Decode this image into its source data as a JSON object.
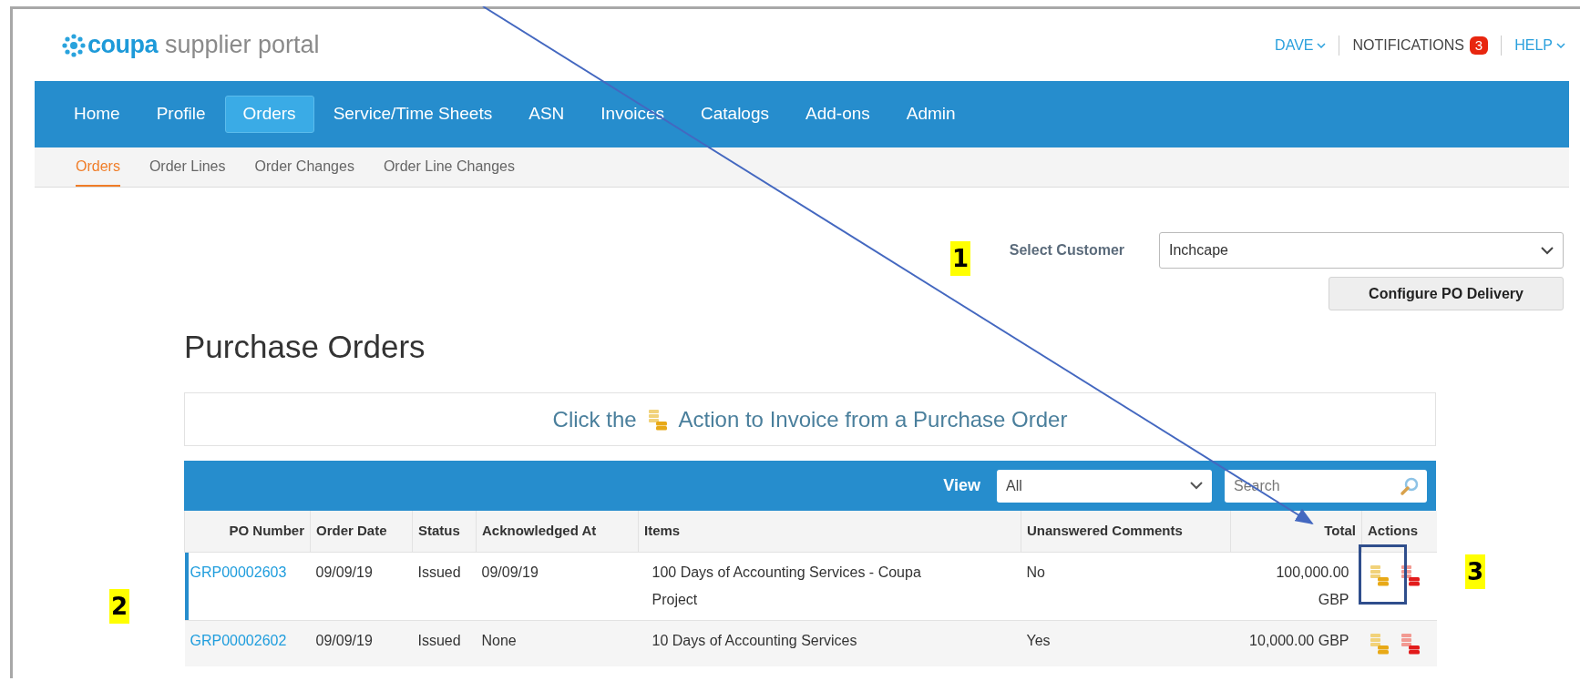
{
  "header": {
    "logo_brand": "coupa",
    "logo_product": "supplier portal",
    "user_menu": "DAVE",
    "notifications_label": "NOTIFICATIONS",
    "notifications_count": "3",
    "help_menu": "HELP"
  },
  "nav": [
    {
      "label": "Home",
      "selected": false
    },
    {
      "label": "Profile",
      "selected": false
    },
    {
      "label": "Orders",
      "selected": true
    },
    {
      "label": "Service/Time Sheets",
      "selected": false
    },
    {
      "label": "ASN",
      "selected": false
    },
    {
      "label": "Invoices",
      "selected": false
    },
    {
      "label": "Catalogs",
      "selected": false
    },
    {
      "label": "Add-ons",
      "selected": false
    },
    {
      "label": "Admin",
      "selected": false
    }
  ],
  "subnav": [
    {
      "label": "Orders",
      "selected": true
    },
    {
      "label": "Order Lines",
      "selected": false
    },
    {
      "label": "Order Changes",
      "selected": false
    },
    {
      "label": "Order Line Changes",
      "selected": false
    }
  ],
  "customer": {
    "label": "Select Customer",
    "value": "Inchcape"
  },
  "configure_button": "Configure PO Delivery",
  "page_title": "Purchase Orders",
  "banner": {
    "before": "Click the",
    "after": "Action to Invoice from a Purchase Order"
  },
  "table": {
    "view_label": "View",
    "view_value": "All",
    "search_placeholder": "Search",
    "columns": [
      "PO Number",
      "Order Date",
      "Status",
      "Acknowledged At",
      "Items",
      "Unanswered Comments",
      "Total",
      "Actions"
    ],
    "rows": [
      {
        "selected": true,
        "cells": [
          "GRP00002603",
          "09/09/19",
          "Issued",
          "09/09/19",
          "100 Days of Accounting Services - Coupa Project",
          "No",
          "100,000.00 GBP"
        ],
        "actions": [
          {
            "kind": "invoice"
          },
          {
            "kind": "credit"
          }
        ]
      },
      {
        "selected": false,
        "cells": [
          "GRP00002602",
          "09/09/19",
          "Issued",
          "None",
          "10 Days of Accounting Services",
          "Yes",
          "10,000.00 GBP"
        ],
        "actions": [
          {
            "kind": "invoice"
          },
          {
            "kind": "credit"
          }
        ]
      }
    ]
  },
  "annotations": [
    {
      "kind": "number",
      "text": "1"
    },
    {
      "kind": "number",
      "text": "2"
    },
    {
      "kind": "number",
      "text": "3"
    },
    {
      "kind": "box"
    },
    {
      "kind": "arrow"
    }
  ]
}
